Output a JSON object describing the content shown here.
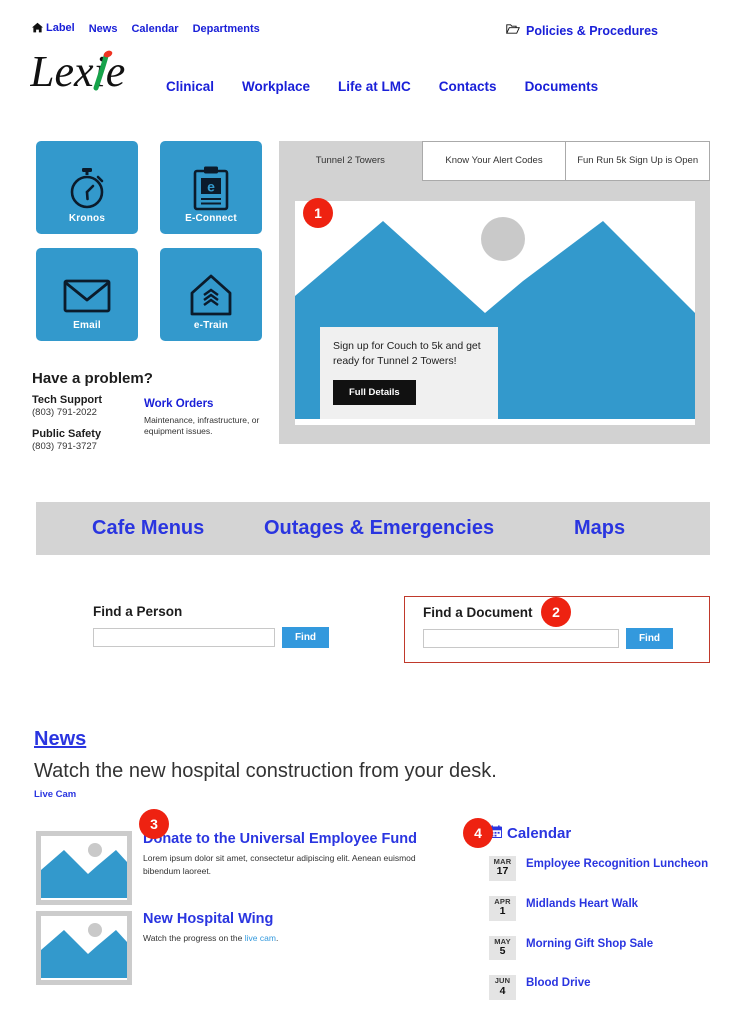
{
  "topnav": {
    "home_icon": "home-icon",
    "items": [
      {
        "label": "Label"
      },
      {
        "label": "News"
      },
      {
        "label": "Calendar"
      },
      {
        "label": "Departments"
      }
    ],
    "policies": {
      "icon": "folder-open-icon",
      "label": "Policies & Procedures"
    }
  },
  "brand": {
    "name": "Lexie",
    "accent_green": "#1aa05a",
    "accent_red": "#ee3322"
  },
  "mainnav": {
    "items": [
      {
        "label": "Clinical"
      },
      {
        "label": "Workplace"
      },
      {
        "label": "Life at LMC"
      },
      {
        "label": "Contacts"
      },
      {
        "label": "Documents"
      }
    ]
  },
  "tiles": [
    {
      "label": "Kronos",
      "icon": "stopwatch-icon"
    },
    {
      "label": "E-Connect",
      "icon": "clipboard-e-icon"
    },
    {
      "label": "Email",
      "icon": "envelope-icon"
    },
    {
      "label": "e-Train",
      "icon": "house-book-icon"
    }
  ],
  "problem": {
    "heading": "Have a problem?",
    "tech_support": {
      "name": "Tech Support",
      "phone": "(803) 791-2022"
    },
    "public_safety": {
      "name": "Public Safety",
      "phone": "(803) 791-3727"
    },
    "work_orders": {
      "label": "Work Orders",
      "description": "Maintenance, infrastructure, or equipment issues."
    }
  },
  "carousel": {
    "tabs": [
      {
        "label": "Tunnel 2 Towers",
        "active": true
      },
      {
        "label": "Know Your Alert Codes",
        "active": false
      },
      {
        "label": "Fun Run 5k Sign Up is Open",
        "active": false
      }
    ],
    "slide": {
      "caption": "Sign up for Couch to 5k and get ready for Tunnel 2 Towers!",
      "button": "Full Details",
      "image": "placeholder-mountain-icon"
    },
    "badge": "1"
  },
  "quickbar": {
    "links": [
      {
        "label": "Cafe Menus"
      },
      {
        "label": "Outages & Emergencies"
      },
      {
        "label": "Maps"
      }
    ]
  },
  "find_person": {
    "label": "Find a Person",
    "value": "",
    "placeholder": "",
    "button": "Find"
  },
  "find_document": {
    "label": "Find a Document",
    "value": "",
    "placeholder": "",
    "button": "Find",
    "badge": "2",
    "highlight_color": "#c0392b"
  },
  "news": {
    "heading": "News",
    "subheading": "Watch the new hospital construction from your desk.",
    "livecam_label": "Live Cam",
    "badge": "3",
    "articles": [
      {
        "title": "Donate to the Universal Employee Fund",
        "text": "Lorem ipsum dolor sit amet, consectetur adipiscing elit. Aenean euismod bibendum laoreet.",
        "thumb": "placeholder-mountain-icon"
      },
      {
        "title": "New Hospital Wing",
        "text_before": "Watch the progress on the ",
        "text_link": "live cam",
        "text_after": ".",
        "thumb": "placeholder-mountain-icon"
      }
    ]
  },
  "calendar": {
    "heading": "Calendar",
    "icon": "calendar-icon",
    "badge": "4",
    "events": [
      {
        "month": "MAR",
        "day": "17",
        "title": "Employee Recognition Luncheon"
      },
      {
        "month": "APR",
        "day": "1",
        "title": "Midlands Heart Walk"
      },
      {
        "month": "MAY",
        "day": "5",
        "title": "Morning Gift Shop Sale"
      },
      {
        "month": "JUN",
        "day": "4",
        "title": "Blood Drive"
      }
    ]
  }
}
